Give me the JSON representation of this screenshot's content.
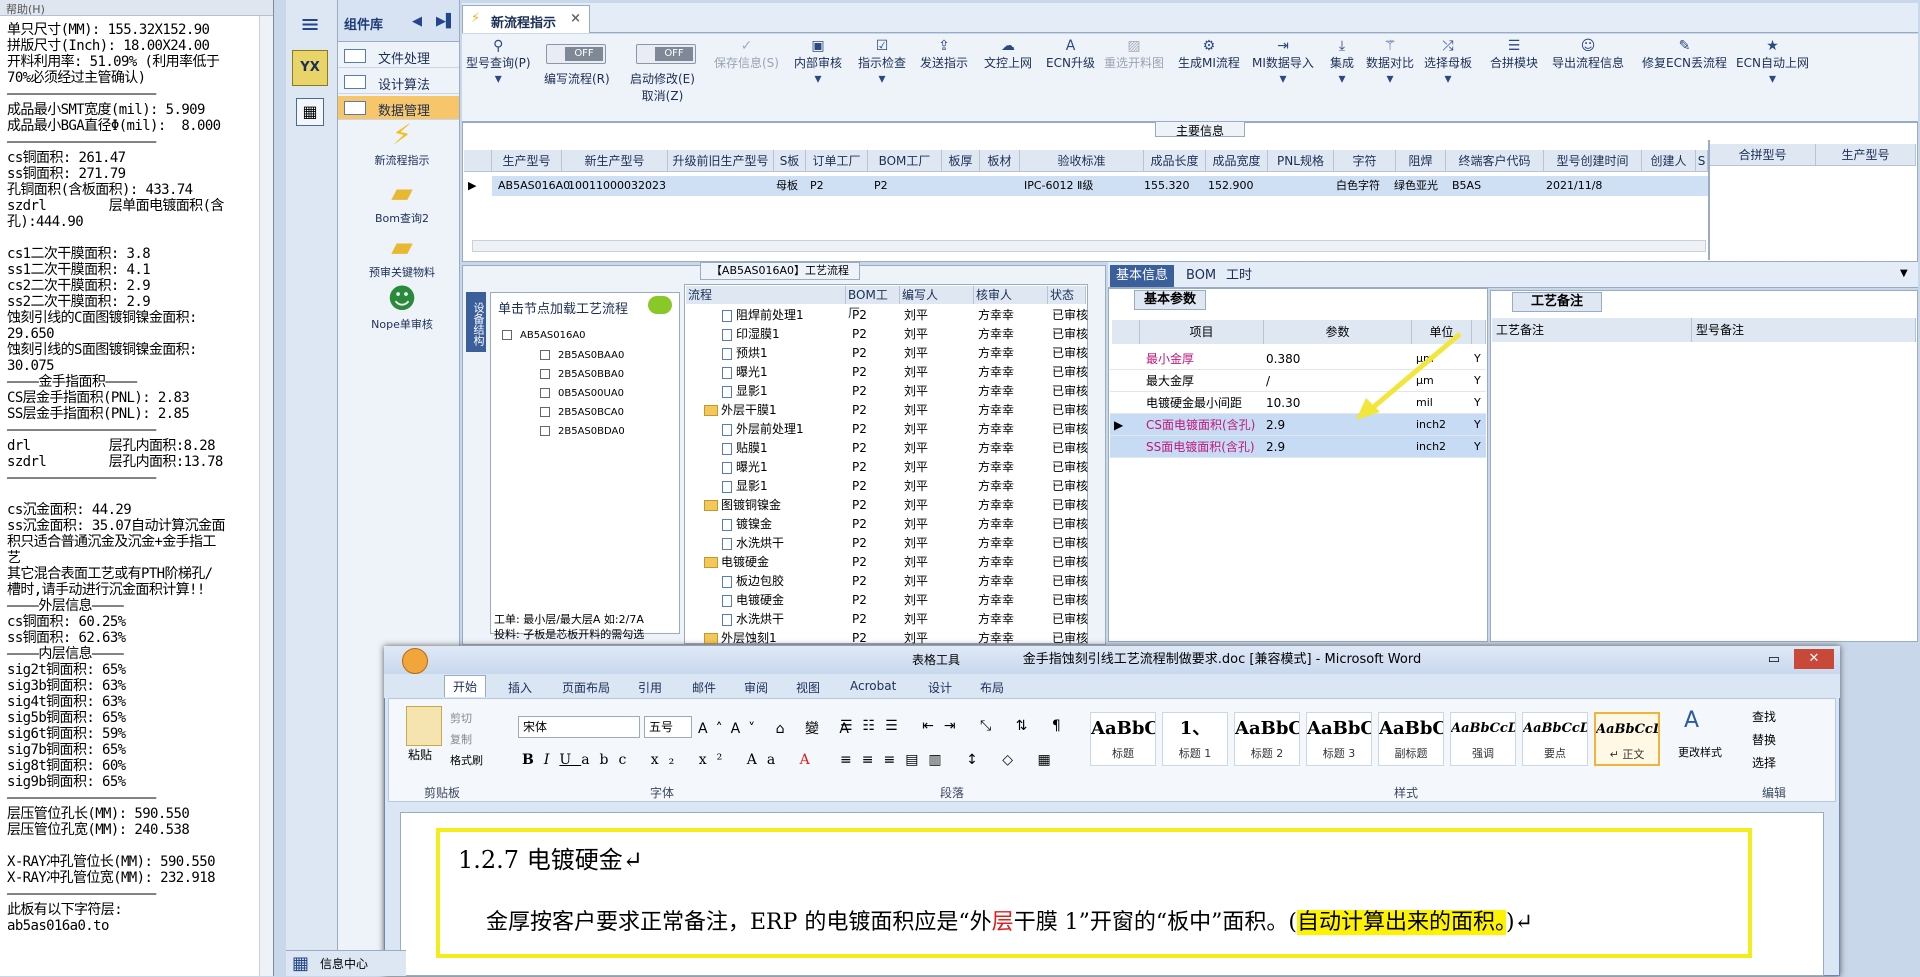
{
  "notepad": {
    "title": "帮助(H)",
    "lines": "单只尺寸(MM): 155.32X152.90\n拼版尺寸(Inch): 18.00X24.00\n开料利用率: 51.09% (利用率低于\n70%必须经过主管确认)\n———————————————————\n成品最小SMT宽度(mil): 5.909\n成品最小BGA直径Φ(mil):  8.000\n———————————————————\ncs铜面积: 261.47\nss铜面积: 271.79\n孔铜面积(含板面积): 433.74\nszdrl        层单面电镀面积(含\n孔):444.90\n\ncs1二次干膜面积: 3.8\nss1二次干膜面积: 4.1\ncs2二次干膜面积: 2.9\nss2二次干膜面积: 2.9\n蚀刻引线的C面图镀铜镍金面积:\n29.650\n蚀刻引线的S面图镀铜镍金面积:\n30.075\n————金手指面积————\nCS层金手指面积(PNL): 2.83\nSS层金手指面积(PNL): 2.85\n———————————————————\ndrl          层孔内面积:8.28\nszdrl        层孔内面积:13.78\n———————————————————\n\ncs沉金面积: 44.29\nss沉金面积: 35.07自动计算沉金面\n积只适合普通沉金及沉金+金手指工\n艺\n其它混合表面工艺或有PTH阶梯孔/\n槽时,请手动进行沉金面积计算!!\n————外层信息————\ncs铜面积: 60.25%\nss铜面积: 62.63%\n————内层信息————\nsig2t铜面积: 65%\nsig3b铜面积: 63%\nsig4t铜面积: 63%\nsig5b铜面积: 65%\nsig6t铜面积: 59%\nsig7b铜面积: 65%\nsig8t铜面积: 60%\nsig9b铜面积: 65%\n———————————————————\n层压管位孔长(MM): 590.550\n层压管位孔宽(MM): 240.538\n\nX-RAY冲孔管位长(MM): 590.550\nX-RAY冲孔管位宽(MM): 232.918\n———————————————————\n此板有以下字符层:\nab5as016a0.to"
  },
  "rail": {
    "menu_icon": "hamburger-icon",
    "logo": "YX"
  },
  "component": {
    "title": "组件库",
    "categories": [
      "文件处理",
      "设计算法",
      "数据管理"
    ],
    "tools": [
      "新流程指示",
      "Bom查询2",
      "预审关键物料",
      "Nope单审核"
    ]
  },
  "tab": {
    "label": "新流程指示",
    "close": "×"
  },
  "ribbon": {
    "items": [
      "型号查询(P)",
      "编写流程(R)",
      "启动修改(E)",
      "保存信息(S)",
      "内部审核",
      "指示检查",
      "发送指示",
      "文控上网",
      "ECN升级",
      "重选开料图",
      "生成MI流程",
      "MI数据导入",
      "集成",
      "数据对比",
      "选择母板",
      "合拼模块",
      "导出流程信息",
      "修复ECN丢流程",
      "ECN自动上网"
    ],
    "sub_cancel": "取消(Z)",
    "toggle_off": "OFF"
  },
  "main_info": {
    "label": "主要信息",
    "headers": [
      "生产型号",
      "新生产型号",
      "升级前旧生产型号",
      "S板",
      "订单工厂",
      "BOM工厂",
      "板厚",
      "板材",
      "验收标准",
      "成品长度",
      "成品宽度",
      "PNL规格",
      "字符",
      "阻焊",
      "终端客户代码",
      "型号创建时间",
      "创建人",
      "S"
    ],
    "row": [
      "AB5AS016A0",
      "10011000032023",
      "",
      "母板",
      "P2",
      "P2",
      "",
      "",
      "IPC-6012 Ⅱ级",
      "155.320",
      "152.900",
      "",
      "白色字符",
      "绿色亚光",
      "B5AS",
      "2021/11/8",
      "",
      ""
    ],
    "right_headers": [
      "合拼型号",
      "生产型号"
    ]
  },
  "process": {
    "title": "【AB5AS016A0】工艺流程",
    "side": "设备结构",
    "tree_head": "单击节点加载工艺流程",
    "tree_root": "AB5AS016A0",
    "tree_items": [
      "2B5AS0BAA0",
      "2B5AS0BBA0",
      "0B5AS00UA0",
      "2B5AS0BCA0",
      "2B5AS0BDA0"
    ],
    "note": "工单: 最小层/最大层A 如:2/7A\n投料: 子板是芯板开料的需勾选",
    "headers": [
      "流程",
      "BOM工厂",
      "编写人",
      "核审人",
      "状态"
    ],
    "rows": [
      {
        "name": "阻焊前处理1",
        "lvl": 2,
        "f": "P2",
        "w": "刘平",
        "r": "方幸幸",
        "s": "已审核"
      },
      {
        "name": "印湿膜1",
        "lvl": 2,
        "f": "P2",
        "w": "刘平",
        "r": "方幸幸",
        "s": "已审核"
      },
      {
        "name": "预烘1",
        "lvl": 2,
        "f": "P2",
        "w": "刘平",
        "r": "方幸幸",
        "s": "已审核"
      },
      {
        "name": "曝光1",
        "lvl": 2,
        "f": "P2",
        "w": "刘平",
        "r": "方幸幸",
        "s": "已审核"
      },
      {
        "name": "显影1",
        "lvl": 2,
        "f": "P2",
        "w": "刘平",
        "r": "方幸幸",
        "s": "已审核"
      },
      {
        "name": "外层干膜1",
        "lvl": 1,
        "f": "P2",
        "w": "刘平",
        "r": "方幸幸",
        "s": "已审核"
      },
      {
        "name": "外层前处理1",
        "lvl": 2,
        "f": "P2",
        "w": "刘平",
        "r": "方幸幸",
        "s": "已审核"
      },
      {
        "name": "贴膜1",
        "lvl": 2,
        "f": "P2",
        "w": "刘平",
        "r": "方幸幸",
        "s": "已审核"
      },
      {
        "name": "曝光1",
        "lvl": 2,
        "f": "P2",
        "w": "刘平",
        "r": "方幸幸",
        "s": "已审核"
      },
      {
        "name": "显影1",
        "lvl": 2,
        "f": "P2",
        "w": "刘平",
        "r": "方幸幸",
        "s": "已审核"
      },
      {
        "name": "图镀铜镍金",
        "lvl": 1,
        "f": "P2",
        "w": "刘平",
        "r": "方幸幸",
        "s": "已审核"
      },
      {
        "name": "镀镍金",
        "lvl": 2,
        "f": "P2",
        "w": "刘平",
        "r": "方幸幸",
        "s": "已审核"
      },
      {
        "name": "水洗烘干",
        "lvl": 2,
        "f": "P2",
        "w": "刘平",
        "r": "方幸幸",
        "s": "已审核"
      },
      {
        "name": "电镀硬金",
        "lvl": 1,
        "f": "P2",
        "w": "刘平",
        "r": "方幸幸",
        "s": "已审核"
      },
      {
        "name": "板边包胶",
        "lvl": 2,
        "f": "P2",
        "w": "刘平",
        "r": "方幸幸",
        "s": "已审核"
      },
      {
        "name": "电镀硬金",
        "lvl": 2,
        "f": "P2",
        "w": "刘平",
        "r": "方幸幸",
        "s": "已审核"
      },
      {
        "name": "水洗烘干",
        "lvl": 2,
        "f": "P2",
        "w": "刘平",
        "r": "方幸幸",
        "s": "已审核"
      },
      {
        "name": "外层蚀刻1",
        "lvl": 1,
        "f": "P2",
        "w": "刘平",
        "r": "方幸幸",
        "s": "已审核"
      }
    ]
  },
  "basic": {
    "tabs": [
      "基本信息",
      "BOM",
      "工时"
    ],
    "label": "基本参数",
    "headers": [
      "项目",
      "参数",
      "单位"
    ],
    "rows": [
      {
        "item": "最小金厚",
        "val": "0.380",
        "unit": "μm",
        "f": "Y",
        "red": true
      },
      {
        "item": "最大金厚",
        "val": "/",
        "unit": "μm",
        "f": "Y",
        "red": false
      },
      {
        "item": "电镀硬金最小间距",
        "val": "10.30",
        "unit": "mil",
        "f": "Y",
        "red": false
      },
      {
        "item": "CS面电镀面积(含孔)",
        "val": "2.9",
        "unit": "inch2",
        "f": "Y",
        "red": true
      },
      {
        "item": "SS面电镀面积(含孔)",
        "val": "2.9",
        "unit": "inch2",
        "f": "Y",
        "red": true
      }
    ]
  },
  "remarks": {
    "label": "工艺备注",
    "headers": [
      "工艺备注",
      "型号备注"
    ]
  },
  "word": {
    "title": "金手指蚀刻引线工艺流程制做要求.doc [兼容模式] - Microsoft Word",
    "tools_label": "表格工具",
    "tabs": [
      "开始",
      "插入",
      "页面布局",
      "引用",
      "邮件",
      "审阅",
      "视图",
      "Acrobat",
      "设计",
      "布局"
    ],
    "clipboard": [
      "粘贴",
      "剪切",
      "复制",
      "格式刷"
    ],
    "font_name": "宋体",
    "font_size": "五号",
    "groups": [
      "剪贴板",
      "字体",
      "段落",
      "样式",
      "编辑"
    ],
    "styles": [
      {
        "sample": "AaBbC",
        "name": "标题"
      },
      {
        "sample": "1、",
        "name": "标题 1"
      },
      {
        "sample": "AaBbC",
        "name": "标题 2"
      },
      {
        "sample": "AaBbC",
        "name": "标题 3"
      },
      {
        "sample": "AaBbC",
        "name": "副标题"
      },
      {
        "sample": "AaBbCcD",
        "name": "强调"
      },
      {
        "sample": "AaBbCcD",
        "name": "要点"
      },
      {
        "sample": "AaBbCcD",
        "name": "↵ 正文"
      }
    ],
    "change_style": "更改样式",
    "edit": [
      "查找",
      "替换",
      "选择"
    ],
    "heading": "1.2.7    电镀硬金↵",
    "body_a": "金厚按客户要求正常备注，ERP  的电镀面积应是“外",
    "body_red": "层",
    "body_b": "干膜 1”开窗的“板中”面积。(",
    "body_yel": "自动计算出来的面积。",
    "body_end": ")↵"
  },
  "taskbar": {
    "label": "信息中心"
  }
}
